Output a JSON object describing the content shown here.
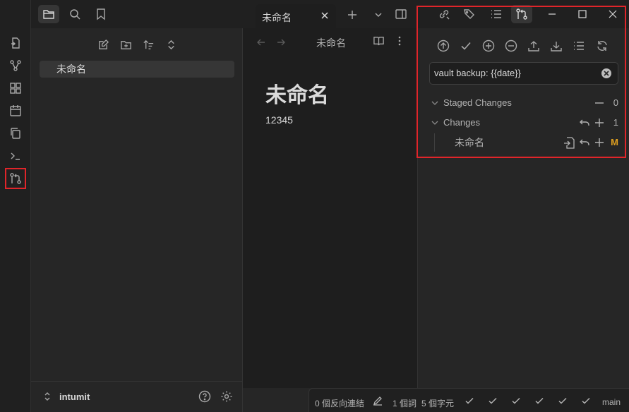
{
  "explorer": {
    "files": [
      "未命名"
    ],
    "vault_name": "intumit"
  },
  "tab": {
    "title": "未命名",
    "view_title": "未命名"
  },
  "note": {
    "heading": "未命名",
    "body": "12345"
  },
  "git": {
    "commit_message": "vault backup: {{date}}",
    "staged_label": "Staged Changes",
    "staged_count": "0",
    "changes_label": "Changes",
    "changes_count": "1",
    "changed_file": "未命名",
    "changed_file_status": "M"
  },
  "statusbar": {
    "backlinks": "0 個反向連結",
    "words": "1 個詞",
    "chars": "5 個字元",
    "branch": "main"
  },
  "colors": {
    "accent_red": "#e0252a",
    "modified": "#e0a020"
  }
}
